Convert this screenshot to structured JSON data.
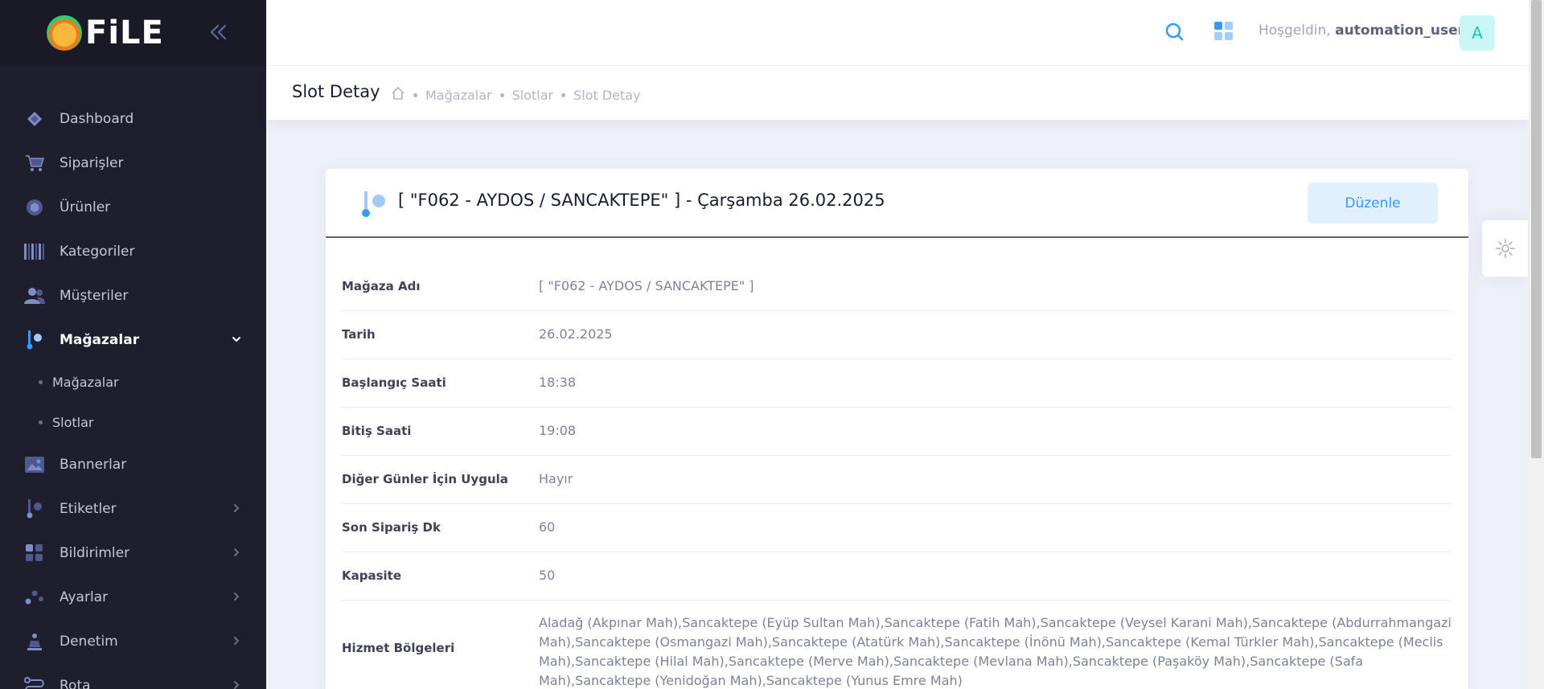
{
  "app": {
    "logo_text": "FiLE"
  },
  "sidebar": {
    "items": [
      {
        "label": "Dashboard",
        "icon": "dashboard-icon"
      },
      {
        "label": "Siparişler",
        "icon": "cart-icon"
      },
      {
        "label": "Ürünler",
        "icon": "box-icon"
      },
      {
        "label": "Kategoriler",
        "icon": "barcode-icon"
      },
      {
        "label": "Müşteriler",
        "icon": "users-icon"
      },
      {
        "label": "Mağazalar",
        "icon": "store-icon",
        "active": true,
        "expanded": true
      },
      {
        "label": "Bannerlar",
        "icon": "image-icon"
      },
      {
        "label": "Etiketler",
        "icon": "tag-icon"
      },
      {
        "label": "Bildirimler",
        "icon": "bell-icon"
      },
      {
        "label": "Ayarlar",
        "icon": "settings-icon"
      },
      {
        "label": "Denetim",
        "icon": "audit-icon"
      },
      {
        "label": "Rota",
        "icon": "route-icon"
      }
    ],
    "sub_items": [
      {
        "label": "Mağazalar"
      },
      {
        "label": "Slotlar"
      }
    ]
  },
  "header": {
    "greeting": "Hoşgeldin,",
    "username": "automation_user",
    "avatar_letter": "A"
  },
  "subheader": {
    "title": "Slot Detay",
    "breadcrumbs": [
      "Mağazalar",
      "Slotlar",
      "Slot Detay"
    ]
  },
  "card": {
    "title": "[ \"F062 - AYDOS / SANCAKTEPE\" ] - Çarşamba 26.02.2025",
    "edit_label": "Düzenle",
    "rows": [
      {
        "label": "Mağaza Adı",
        "value": "[ \"F062 - AYDOS / SANCAKTEPE\" ]"
      },
      {
        "label": "Tarih",
        "value": "26.02.2025"
      },
      {
        "label": "Başlangıç Saati",
        "value": "18:38"
      },
      {
        "label": "Bitiş Saati",
        "value": "19:08"
      },
      {
        "label": "Diğer Günler İçin Uygula",
        "value": "Hayır"
      },
      {
        "label": "Son Sipariş Dk",
        "value": "60"
      },
      {
        "label": "Kapasite",
        "value": "50"
      },
      {
        "label": "Hizmet Bölgeleri",
        "value": "Aladağ (Akpınar Mah),Sancaktepe (Eyüp Sultan Mah),Sancaktepe (Fatih Mah),Sancaktepe (Veysel Karani Mah),Sancaktepe (Abdurrahmangazi Mah),Sancaktepe (Osmangazi Mah),Sancaktepe (Atatürk Mah),Sancaktepe (İnönü Mah),Sancaktepe (Kemal Türkler Mah),Sancaktepe (Meclis Mah),Sancaktepe (Hilal Mah),Sancaktepe (Merve Mah),Sancaktepe (Mevlana Mah),Sancaktepe (Paşaköy Mah),Sancaktepe (Safa Mah),Sancaktepe (Yenidoğan Mah),Sancaktepe (Yunus Emre Mah)"
      }
    ]
  },
  "colors": {
    "sidebar_bg": "#1e1e2d",
    "accent": "#3699ff",
    "page_bg": "#eef0f8"
  }
}
